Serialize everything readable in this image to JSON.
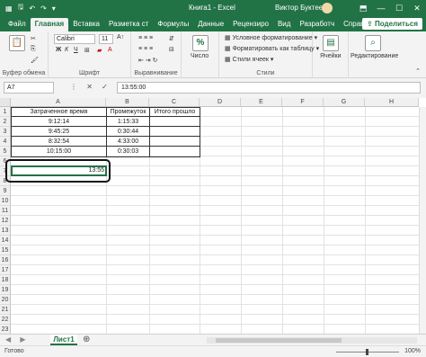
{
  "titlebar": {
    "title": "Книга1 - Excel",
    "user": "Виктор Буктеев",
    "min": "—",
    "max": "☐",
    "close": "✕"
  },
  "tabs": [
    "Файл",
    "Главная",
    "Вставка",
    "Разметка ст",
    "Формулы",
    "Данные",
    "Рецензиро",
    "Вид",
    "Разработч",
    "Справка"
  ],
  "active_tab": "Главная",
  "share_label": "Поделиться",
  "ribbon": {
    "clipboard_label": "Буфер обмена",
    "font_name": "Calibri",
    "font_size": "11",
    "font_label": "Шрифт",
    "align_label": "Выравнивание",
    "number_btn": "Число",
    "number_symbol": "%",
    "cond_format": "Условное форматирование",
    "format_table": "Форматировать как таблицу",
    "cell_styles": "Стили ячеек",
    "styles_label": "Стили",
    "cells_btn": "Ячейки",
    "edit_btn": "Редактирование"
  },
  "formula_bar": {
    "name_box": "A7",
    "formula": "13:55:00"
  },
  "columns": [
    "A",
    "B",
    "C",
    "D",
    "E",
    "F",
    "G",
    "H"
  ],
  "rows": [
    "1",
    "2",
    "3",
    "4",
    "5",
    "6",
    "7",
    "8",
    "9",
    "10",
    "11",
    "12",
    "13",
    "14",
    "15",
    "16",
    "17",
    "18",
    "19",
    "20",
    "21",
    "22",
    "23"
  ],
  "table": {
    "headers": [
      "Затраченное время",
      "Промежуток",
      "Итого прошло"
    ],
    "data": [
      [
        "9:12:14",
        "1:15:33",
        ""
      ],
      [
        "9:45:25",
        "0:30:44",
        ""
      ],
      [
        "8:32:54",
        "4:33:00",
        ""
      ],
      [
        "10:15:00",
        "0:30:03",
        ""
      ]
    ]
  },
  "selected_cell_value": "13:55",
  "sheet_tab": "Лист1",
  "status": {
    "text": "Готово",
    "zoom": "100%"
  }
}
